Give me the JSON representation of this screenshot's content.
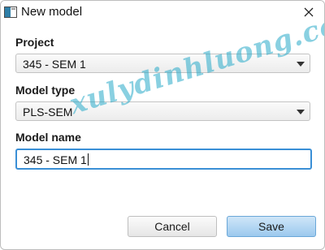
{
  "window": {
    "title": "New model",
    "close_icon": "close-icon",
    "app_icon": "app-window-icon"
  },
  "project": {
    "label": "Project",
    "selected": "345 - SEM 1"
  },
  "model_type": {
    "label": "Model type",
    "selected": "PLS-SEM"
  },
  "model_name": {
    "label": "Model name",
    "value": "345 - SEM 1"
  },
  "buttons": {
    "cancel": "Cancel",
    "save": "Save"
  },
  "watermark": "xulydinhluong.com",
  "colors": {
    "focus_border": "#3a8fd6",
    "save_button": "#9cc9ee",
    "watermark": "#28aac8"
  }
}
